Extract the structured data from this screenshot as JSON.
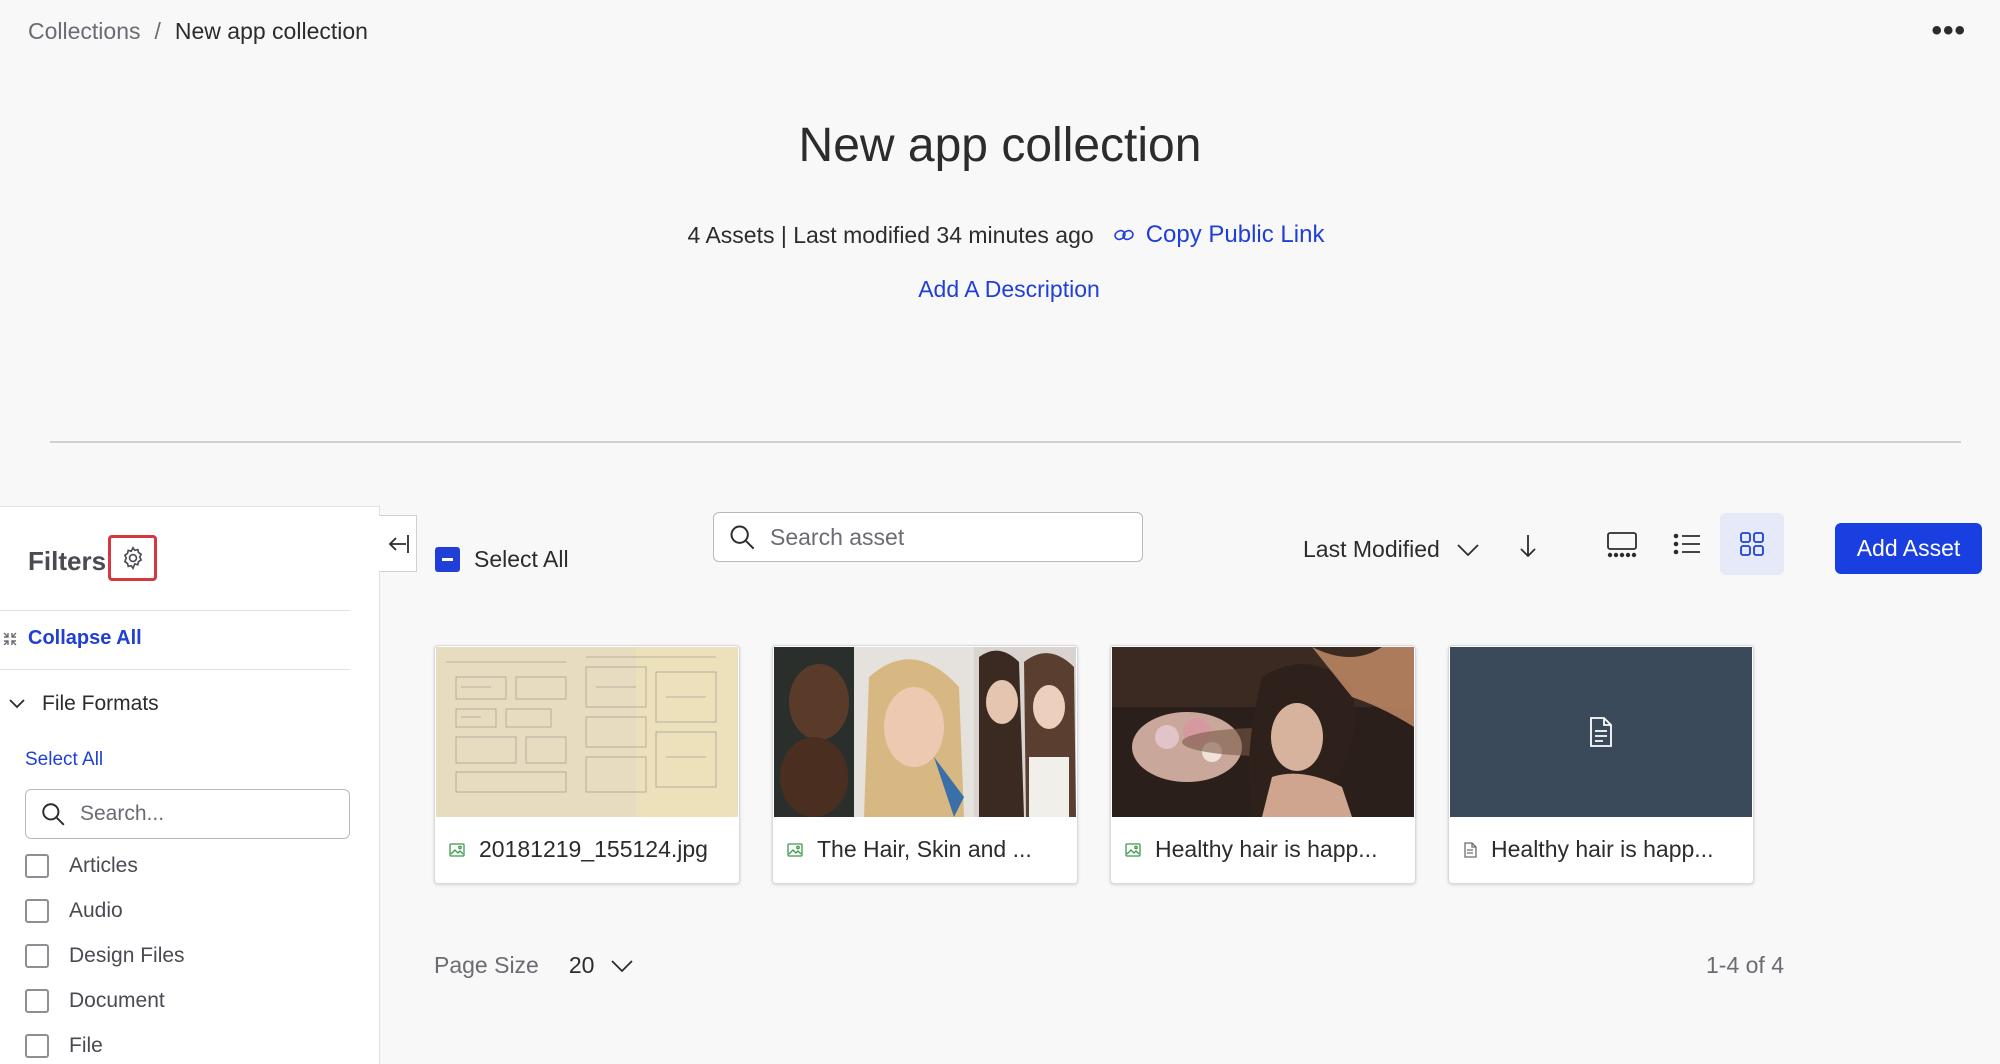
{
  "breadcrumb": {
    "parent": "Collections",
    "separator": "/",
    "current": "New app collection"
  },
  "more_menu": "•••",
  "header": {
    "title": "New app collection",
    "meta": "4 Assets | Last modified 34 minutes ago",
    "copy_link": "Copy Public Link",
    "add_description": "Add A Description"
  },
  "filters": {
    "title": "Filters",
    "collapse_all": "Collapse All",
    "section": "File Formats",
    "select_all": "Select All",
    "search_placeholder": "Search...",
    "formats": [
      "Articles",
      "Audio",
      "Design Files",
      "Document",
      "File"
    ]
  },
  "toolbar": {
    "select_all": "Select All",
    "search_placeholder": "Search asset",
    "sort_label": "Last Modified",
    "add_asset": "Add Asset",
    "active_view": "grid"
  },
  "assets": [
    {
      "name": "20181219_155124.jpg",
      "type": "image",
      "thumb": "sketch"
    },
    {
      "name": "The Hair, Skin and ...",
      "type": "image",
      "thumb": "models"
    },
    {
      "name": "Healthy hair is happ...",
      "type": "image",
      "thumb": "salon"
    },
    {
      "name": "Healthy hair is happ...",
      "type": "document",
      "thumb": "doc"
    }
  ],
  "footer": {
    "page_size_label": "Page Size",
    "page_size": "20",
    "range": "1-4 of 4"
  },
  "colors": {
    "accent": "#1f3fd6",
    "button": "#1a3fe0",
    "highlight_border": "#d7373f",
    "doc_thumb": "#3b4a5a"
  }
}
